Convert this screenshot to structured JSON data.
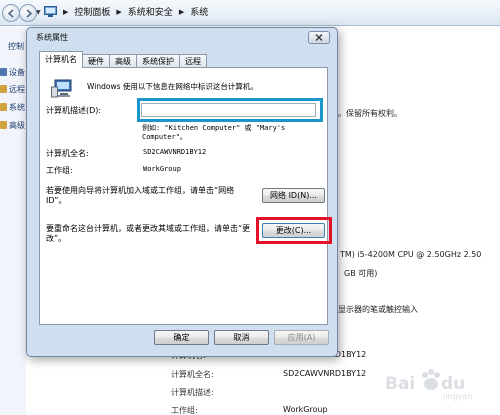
{
  "addressbar": {
    "breadcrumb": [
      "控制面板",
      "系统和安全",
      "系统"
    ]
  },
  "sidebar": {
    "title_fragment": "控制",
    "items": [
      "设备",
      "远程",
      "系统",
      "高级"
    ]
  },
  "background": {
    "rights_text": "。保留所有权利。",
    "cpu_text": "TM) i5-4200M CPU @ 2.50GHz   2.50",
    "ram_text": "GB 可用)",
    "touch_text": "显示器的笔或触控输入",
    "rows": [
      {
        "label": "计算机名:",
        "value": "SD2CAWVNRD1BY12"
      },
      {
        "label": "计算机全名:",
        "value": "SD2CAWVNRD1BY12"
      },
      {
        "label": "计算机描述:",
        "value": ""
      },
      {
        "label": "工作组:",
        "value": "WorkGroup"
      }
    ]
  },
  "dialog": {
    "title": "系统属性",
    "tabs": [
      "计算机名",
      "硬件",
      "高级",
      "系统保护",
      "远程"
    ],
    "active_tab": "计算机名",
    "intro": "Windows 使用以下信息在网络中标识这台计算机。",
    "description_label": "计算机描述(D):",
    "description_value": "",
    "example": "例如: \"Kitchen Computer\" 或 \"Mary's Computer\"。",
    "full_name_label": "计算机全名:",
    "full_name_value": "SD2CAWVNRD1BY12",
    "workgroup_label": "工作组:",
    "workgroup_value": "WorkGroup",
    "network_id_text": "若要使用向导将计算机加入域或工作组，请单击“网络 ID”。",
    "network_id_button": "网络 ID(N)...",
    "rename_text": "要重命名这台计算机，或者更改其域或工作组，请单击“更改”。",
    "change_button": "更改(C)...",
    "ok_button": "确定",
    "cancel_button": "取消",
    "apply_button": "应用(A)"
  },
  "watermark": "Baidu 经验",
  "colors": {
    "highlight_blue": "#1d95cd",
    "highlight_red": "#e3122a",
    "dialog_frame": "#cfdff0"
  }
}
